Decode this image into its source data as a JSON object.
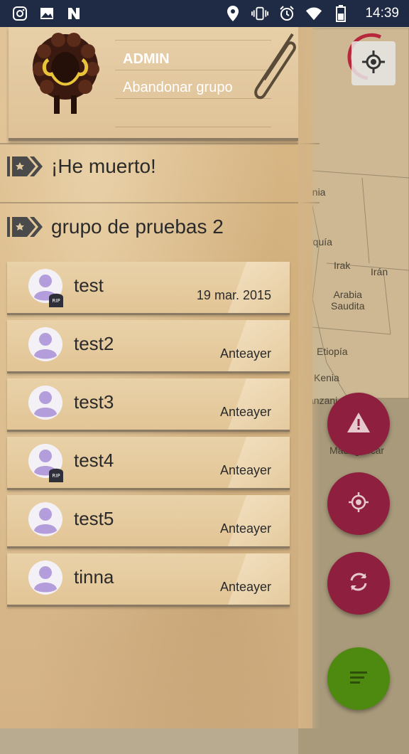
{
  "status_bar": {
    "time": "14:39",
    "icons": [
      "instagram-icon",
      "gallery-icon",
      "n-icon",
      "location-icon",
      "vibrate-icon",
      "alarm-icon",
      "wifi-icon",
      "battery-icon"
    ]
  },
  "map": {
    "labels": [
      "ania",
      "rquía",
      "Irak",
      "Irán",
      "Arabia\nSaudita",
      "Etiopía",
      "Kenia",
      "anzani",
      "Madagascar"
    ]
  },
  "drawer": {
    "admin_label": "ADMIN",
    "leave_group_label": "Abandonar grupo",
    "groups": [
      {
        "title": "¡He muerto!"
      },
      {
        "title": "grupo de pruebas 2"
      }
    ],
    "members": [
      {
        "name": "test",
        "date": "19 mar. 2015",
        "rip": true
      },
      {
        "name": "test2",
        "date": "Anteayer",
        "rip": false
      },
      {
        "name": "test3",
        "date": "Anteayer",
        "rip": false
      },
      {
        "name": "test4",
        "date": "Anteayer",
        "rip": true
      },
      {
        "name": "test5",
        "date": "Anteayer",
        "rip": false
      },
      {
        "name": "tinna",
        "date": "Anteayer",
        "rip": false
      }
    ],
    "rip_badge_text": "RIP"
  },
  "fabs": {
    "alert_color": "#8e1f3f",
    "target_color": "#8e1f3f",
    "refresh_color": "#8e1f3f",
    "list_color": "#4e8a0f"
  },
  "colors": {
    "status_bar": "#1f2a44",
    "paper": "#d8b98b",
    "avatar_purple": "#b39ddb"
  }
}
